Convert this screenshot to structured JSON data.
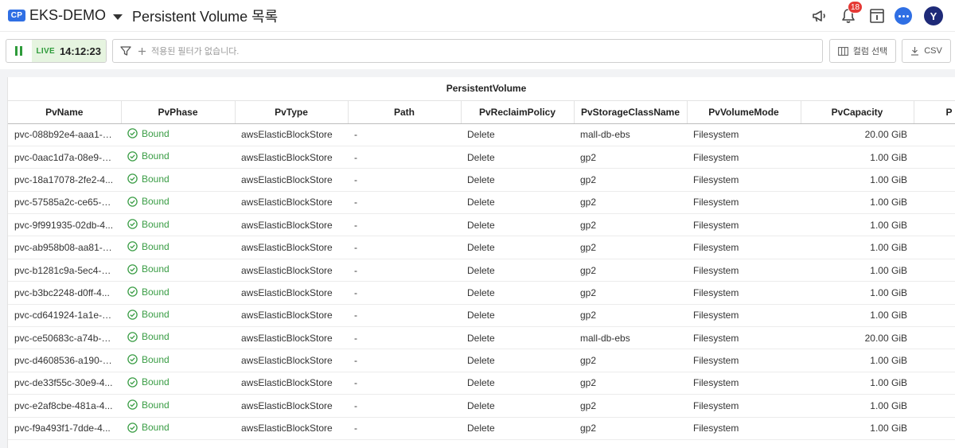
{
  "header": {
    "cluster_badge": "CP",
    "cluster_name": "EKS-DEMO",
    "page_title": "Persistent Volume 목록",
    "notification_count": "18",
    "avatar_initial": "Y"
  },
  "toolbar": {
    "live_label": "LIVE",
    "live_time": "14:12:23",
    "filter_placeholder": "적용된 필터가 없습니다.",
    "column_select_label": "컬럼 선택",
    "csv_label": "CSV"
  },
  "table": {
    "group_header": "PersistentVolume",
    "columns": [
      "PvName",
      "PvPhase",
      "PvType",
      "Path",
      "PvReclaimPolicy",
      "PvStorageClassName",
      "PvVolumeMode",
      "PvCapacity",
      "P"
    ],
    "rows": [
      {
        "name": "pvc-088b92e4-aaa1-4...",
        "phase": "Bound",
        "type": "awsElasticBlockStore",
        "path": "-",
        "reclaim": "Delete",
        "storage_class": "mall-db-ebs",
        "volume_mode": "Filesystem",
        "capacity": "20.00 GiB"
      },
      {
        "name": "pvc-0aac1d7a-08e9-4...",
        "phase": "Bound",
        "type": "awsElasticBlockStore",
        "path": "-",
        "reclaim": "Delete",
        "storage_class": "gp2",
        "volume_mode": "Filesystem",
        "capacity": "1.00 GiB"
      },
      {
        "name": "pvc-18a17078-2fe2-4...",
        "phase": "Bound",
        "type": "awsElasticBlockStore",
        "path": "-",
        "reclaim": "Delete",
        "storage_class": "gp2",
        "volume_mode": "Filesystem",
        "capacity": "1.00 GiB"
      },
      {
        "name": "pvc-57585a2c-ce65-4...",
        "phase": "Bound",
        "type": "awsElasticBlockStore",
        "path": "-",
        "reclaim": "Delete",
        "storage_class": "gp2",
        "volume_mode": "Filesystem",
        "capacity": "1.00 GiB"
      },
      {
        "name": "pvc-9f991935-02db-4...",
        "phase": "Bound",
        "type": "awsElasticBlockStore",
        "path": "-",
        "reclaim": "Delete",
        "storage_class": "gp2",
        "volume_mode": "Filesystem",
        "capacity": "1.00 GiB"
      },
      {
        "name": "pvc-ab958b08-aa81-4...",
        "phase": "Bound",
        "type": "awsElasticBlockStore",
        "path": "-",
        "reclaim": "Delete",
        "storage_class": "gp2",
        "volume_mode": "Filesystem",
        "capacity": "1.00 GiB"
      },
      {
        "name": "pvc-b1281c9a-5ec4-4...",
        "phase": "Bound",
        "type": "awsElasticBlockStore",
        "path": "-",
        "reclaim": "Delete",
        "storage_class": "gp2",
        "volume_mode": "Filesystem",
        "capacity": "1.00 GiB"
      },
      {
        "name": "pvc-b3bc2248-d0ff-4...",
        "phase": "Bound",
        "type": "awsElasticBlockStore",
        "path": "-",
        "reclaim": "Delete",
        "storage_class": "gp2",
        "volume_mode": "Filesystem",
        "capacity": "1.00 GiB"
      },
      {
        "name": "pvc-cd641924-1a1e-4...",
        "phase": "Bound",
        "type": "awsElasticBlockStore",
        "path": "-",
        "reclaim": "Delete",
        "storage_class": "gp2",
        "volume_mode": "Filesystem",
        "capacity": "1.00 GiB"
      },
      {
        "name": "pvc-ce50683c-a74b-4...",
        "phase": "Bound",
        "type": "awsElasticBlockStore",
        "path": "-",
        "reclaim": "Delete",
        "storage_class": "mall-db-ebs",
        "volume_mode": "Filesystem",
        "capacity": "20.00 GiB"
      },
      {
        "name": "pvc-d4608536-a190-4...",
        "phase": "Bound",
        "type": "awsElasticBlockStore",
        "path": "-",
        "reclaim": "Delete",
        "storage_class": "gp2",
        "volume_mode": "Filesystem",
        "capacity": "1.00 GiB"
      },
      {
        "name": "pvc-de33f55c-30e9-4...",
        "phase": "Bound",
        "type": "awsElasticBlockStore",
        "path": "-",
        "reclaim": "Delete",
        "storage_class": "gp2",
        "volume_mode": "Filesystem",
        "capacity": "1.00 GiB"
      },
      {
        "name": "pvc-e2af8cbe-481a-4...",
        "phase": "Bound",
        "type": "awsElasticBlockStore",
        "path": "-",
        "reclaim": "Delete",
        "storage_class": "gp2",
        "volume_mode": "Filesystem",
        "capacity": "1.00 GiB"
      },
      {
        "name": "pvc-f9a493f1-7dde-4...",
        "phase": "Bound",
        "type": "awsElasticBlockStore",
        "path": "-",
        "reclaim": "Delete",
        "storage_class": "gp2",
        "volume_mode": "Filesystem",
        "capacity": "1.00 GiB"
      }
    ]
  },
  "colors": {
    "accent": "#2f6fe4",
    "live_green": "#2e9b3a",
    "bound_green": "#3a9d45",
    "notification_red": "#e53935",
    "avatar_navy": "#1e2a78"
  },
  "icons": [
    "megaphone-icon",
    "bell-icon",
    "info-panel-icon",
    "chat-icon",
    "pause-icon",
    "filter-icon",
    "plus-icon",
    "columns-icon",
    "download-icon",
    "check-circle-icon"
  ]
}
